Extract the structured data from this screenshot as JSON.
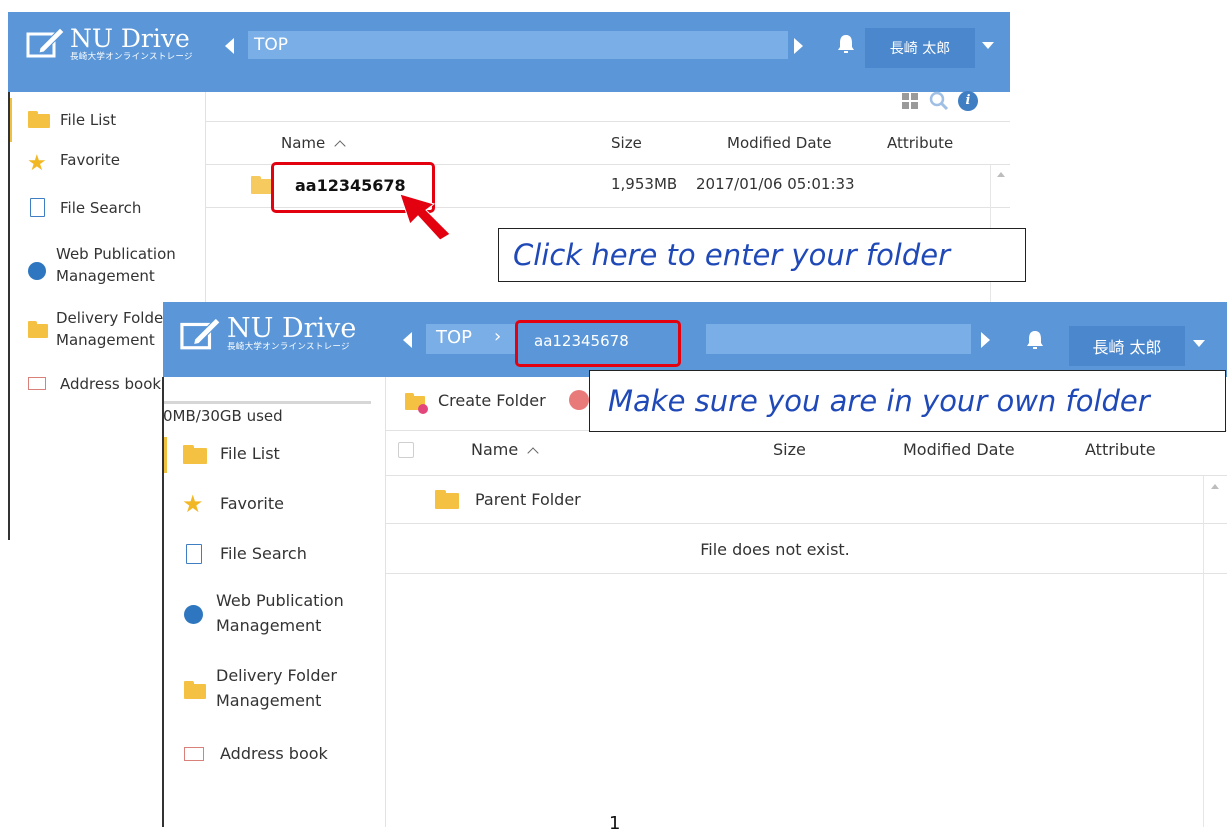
{
  "app": {
    "name": "NU Drive",
    "subtitle": "長崎大学オンラインストレージ"
  },
  "header": {
    "path_root": "TOP",
    "path_folder": "aa12345678",
    "user": "長崎 太郎",
    "user_top": "長崎 太郎"
  },
  "sidebar": {
    "usage": "0MB/30GB used",
    "items": [
      {
        "label": "File List",
        "icon": "folder-icon"
      },
      {
        "label": "Favorite",
        "icon": "star-icon"
      },
      {
        "label": "File Search",
        "icon": "file-search-icon"
      },
      {
        "label": "Web Publication",
        "label2": "Management",
        "icon": "globe-icon"
      },
      {
        "label": "Delivery Folder",
        "label2": "Management",
        "icon": "delivery-folder-icon"
      },
      {
        "label": "Address book",
        "icon": "address-book-icon"
      }
    ],
    "items_top_cut": {
      "delivery": "Delivery Folde"
    }
  },
  "toolbar": {
    "create_folder": "Create Folder"
  },
  "table": {
    "columns": {
      "name": "Name",
      "size": "Size",
      "modified": "Modified Date",
      "attribute": "Attribute"
    },
    "sort_indicator": "^",
    "top_row": {
      "name": "aa12345678",
      "size": "1,953MB",
      "modified": "2017/01/06 05:01:33"
    },
    "parent_folder": "Parent Folder",
    "empty_message": "File does not exist."
  },
  "annotations": {
    "callout1": "Click here to enter your folder",
    "callout2": "Make sure you are in your own folder"
  },
  "page_number": "1",
  "colors": {
    "header": "#5b97d8",
    "accent_red": "#e3000f",
    "callout_text": "#2049b8"
  }
}
